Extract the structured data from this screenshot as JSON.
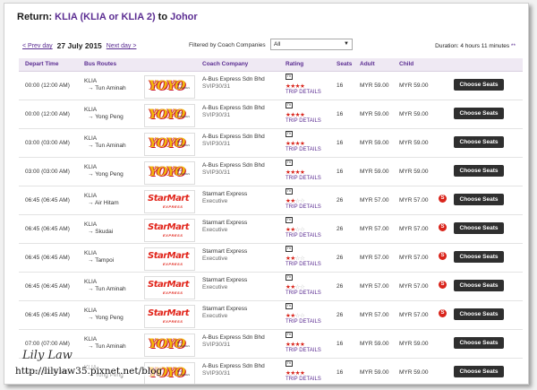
{
  "header": {
    "prefix": "Return: ",
    "origin": "KLIA (KLIA or KLIA 2)",
    "to": " to ",
    "destination": "Johor"
  },
  "datebar": {
    "prev": "< Prev day",
    "date": "27 July 2015",
    "next": "Next day >"
  },
  "filter": {
    "label": "Filtered by Coach Companies",
    "value": "All"
  },
  "duration": {
    "text": "Duration: 4 hours 11 minutes",
    "mark": " **"
  },
  "columns": {
    "depart": "Depart Time",
    "routes": "Bus Routes",
    "company": "Coach Company",
    "rating": "Rating",
    "seats": "Seats",
    "adult": "Adult",
    "child": "Child"
  },
  "common": {
    "trip_details": "TRIP DETAILS",
    "choose": "Choose Seats",
    "yoyo_logo": "YOYO",
    "yoyo_tag": "BAS EKSPRES",
    "starmart_logo": "StarMart",
    "starmart_sub": "EXPRESS",
    "badge": "S"
  },
  "rows": [
    {
      "time": "00:00 (12:00 AM)",
      "from": "KLIA",
      "to": "→ Tun Aminah",
      "logo": "yoyo",
      "company": "A-Bus Express Sdn Bhd",
      "type": "SVIP30/31",
      "rating": 4,
      "seats": "16",
      "adult": "MYR 59.00",
      "child": "MYR 59.00",
      "badge": false
    },
    {
      "time": "00:00 (12:00 AM)",
      "from": "KLIA",
      "to": "→ Yong Peng",
      "logo": "yoyo",
      "company": "A-Bus Express Sdn Bhd",
      "type": "SVIP30/31",
      "rating": 4,
      "seats": "16",
      "adult": "MYR 59.00",
      "child": "MYR 59.00",
      "badge": false
    },
    {
      "time": "03:00 (03:00 AM)",
      "from": "KLIA",
      "to": "→ Tun Aminah",
      "logo": "yoyo",
      "company": "A-Bus Express Sdn Bhd",
      "type": "SVIP30/31",
      "rating": 4,
      "seats": "16",
      "adult": "MYR 59.00",
      "child": "MYR 59.00",
      "badge": false
    },
    {
      "time": "03:00 (03:00 AM)",
      "from": "KLIA",
      "to": "→ Yong Peng",
      "logo": "yoyo",
      "company": "A-Bus Express Sdn Bhd",
      "type": "SVIP30/31",
      "rating": 4,
      "seats": "16",
      "adult": "MYR 59.00",
      "child": "MYR 59.00",
      "badge": false
    },
    {
      "time": "06:45 (06:45 AM)",
      "from": "KLIA",
      "to": "→ Air Hitam",
      "logo": "starmart",
      "company": "Starmart Express",
      "type": "Executive",
      "rating": 2,
      "seats": "26",
      "adult": "MYR 57.00",
      "child": "MYR 57.00",
      "badge": true
    },
    {
      "time": "06:45 (06:45 AM)",
      "from": "KLIA",
      "to": "→ Skudai",
      "logo": "starmart",
      "company": "Starmart Express",
      "type": "Executive",
      "rating": 2,
      "seats": "26",
      "adult": "MYR 57.00",
      "child": "MYR 57.00",
      "badge": true
    },
    {
      "time": "06:45 (06:45 AM)",
      "from": "KLIA",
      "to": "→ Tampoi",
      "logo": "starmart",
      "company": "Starmart Express",
      "type": "Executive",
      "rating": 2,
      "seats": "26",
      "adult": "MYR 57.00",
      "child": "MYR 57.00",
      "badge": true
    },
    {
      "time": "06:45 (06:45 AM)",
      "from": "KLIA",
      "to": "→ Tun Aminah",
      "logo": "starmart",
      "company": "Starmart Express",
      "type": "Executive",
      "rating": 2,
      "seats": "26",
      "adult": "MYR 57.00",
      "child": "MYR 57.00",
      "badge": true
    },
    {
      "time": "06:45 (06:45 AM)",
      "from": "KLIA",
      "to": "→ Yong Peng",
      "logo": "starmart",
      "company": "Starmart Express",
      "type": "Executive",
      "rating": 2,
      "seats": "26",
      "adult": "MYR 57.00",
      "child": "MYR 57.00",
      "badge": true
    },
    {
      "time": "07:00 (07:00 AM)",
      "from": "KLIA",
      "to": "→ Tun Aminah",
      "logo": "yoyo",
      "company": "A-Bus Express Sdn Bhd",
      "type": "SVIP30/31",
      "rating": 4,
      "seats": "16",
      "adult": "MYR 59.00",
      "child": "MYR 59.00",
      "badge": false
    },
    {
      "time": "07:00 (07:00 AM)",
      "from": "KLIA",
      "to": "→ Yong Peng",
      "logo": "yoyo",
      "company": "A-Bus Express Sdn Bhd",
      "type": "SVIP30/31",
      "rating": 4,
      "seats": "16",
      "adult": "MYR 59.00",
      "child": "MYR 59.00",
      "badge": false
    }
  ],
  "watermark": {
    "name": "Lily Law",
    "url": "http://lilylaw35.pixnet.net/blog"
  },
  "colors": {
    "accent": "#5b2d92",
    "header_bg": "#efe9f3",
    "button": "#2f2f2f",
    "star": "#d9241b"
  }
}
